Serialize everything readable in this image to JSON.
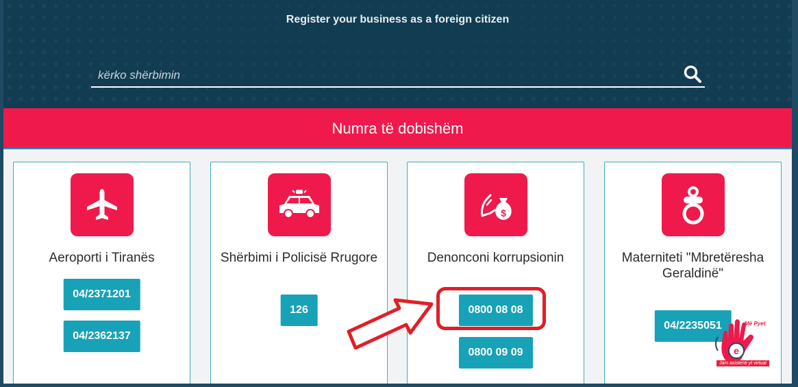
{
  "header": {
    "link": "Register your business as a foreign citizen",
    "search_placeholder": "kërko shërbimin"
  },
  "banner": {
    "title": "Numra të dobishëm"
  },
  "cards": [
    {
      "icon": "airplane-icon",
      "title": "Aeroporti i Tiranës",
      "phones": [
        "04/2371201",
        "04/2362137"
      ]
    },
    {
      "icon": "police-car-icon",
      "title": "Shërbimi i Policisë Rrugore",
      "phones": [
        "126"
      ]
    },
    {
      "icon": "bribe-money-icon",
      "title": "Denonconi korrupsionin",
      "phones": [
        "0800 08 08",
        "0800 09 09"
      ]
    },
    {
      "icon": "pacifier-icon",
      "title": "Materniteti \"Mbretëresha Geraldinë\"",
      "phones": [
        "04/2235051"
      ]
    }
  ],
  "assistant": {
    "top": "Më Pyet",
    "label": "Jam asistenti yt virtual"
  },
  "colors": {
    "accent": "#ef1a4b",
    "teal": "#17a2b8",
    "header_bg": "#113c52",
    "annotation": "#e21e26"
  }
}
